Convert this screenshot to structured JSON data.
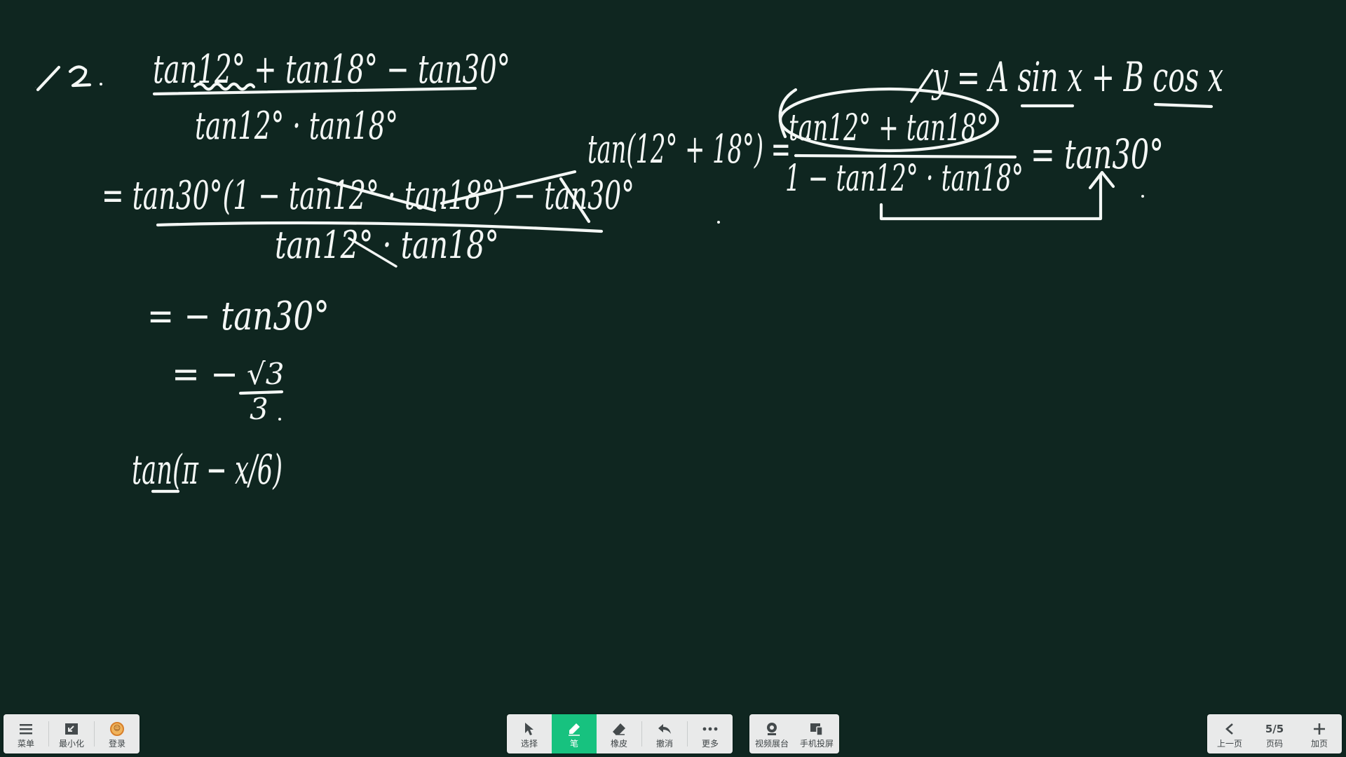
{
  "board": {
    "background": "#0f2620",
    "ink_color": "#f4f7f5",
    "problem_number": "12.",
    "numerator": "tan12° + tan18° − tan30°",
    "denominator": "tan12° · tan18°",
    "step1_numerator": "= tan30°(1 − tan12° · tan18°) − tan30°",
    "step1_denominator": "tan12° · tan18°",
    "step2": "= − tan30°",
    "step3_prefix": "= −",
    "step3_numerator": "√3",
    "step3_denominator": "3",
    "step4": "tan(π − x/6)",
    "identity_top": "y = A sin x + B cos x",
    "identity_left": "tan(12° + 18°) =",
    "identity_numerator": "tan12° + tan18°",
    "identity_denominator": "1 − tan12° · tan18°",
    "identity_result": "= tan30°"
  },
  "left_toolbar": {
    "menu": {
      "label": "菜单",
      "icon": "menu-icon"
    },
    "minimize": {
      "label": "最小化",
      "icon": "minimize-icon"
    },
    "login": {
      "label": "登录",
      "icon": "avatar-icon"
    }
  },
  "center_toolbar": {
    "select": {
      "label": "选择",
      "icon": "cursor-icon"
    },
    "pen": {
      "label": "笔",
      "icon": "pen-icon",
      "active": true,
      "active_color": "#17c27f"
    },
    "eraser": {
      "label": "橡皮",
      "icon": "eraser-icon"
    },
    "undo": {
      "label": "撤消",
      "icon": "undo-icon"
    },
    "more": {
      "label": "更多",
      "icon": "more-icon"
    }
  },
  "media_toolbar": {
    "document_camera": {
      "label": "视频展台",
      "icon": "camera-icon"
    },
    "phone_projection": {
      "label": "手机投屏",
      "icon": "phone-projection-icon"
    }
  },
  "page_toolbar": {
    "prev": {
      "label": "上一页",
      "icon": "chevron-left-icon"
    },
    "page_indicator": {
      "value": "5/5",
      "label": "页码"
    },
    "add": {
      "label": "加页",
      "icon": "plus-icon"
    }
  }
}
